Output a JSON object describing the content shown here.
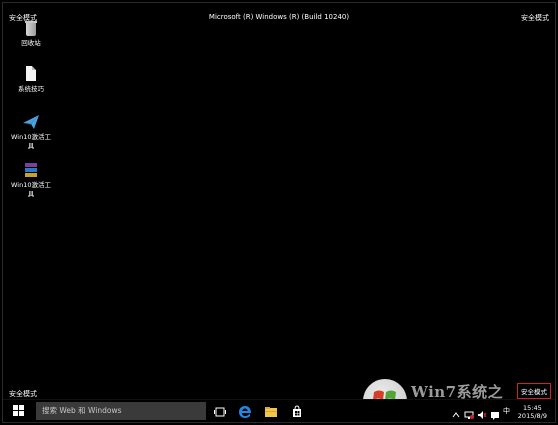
{
  "top_bar": {
    "left_label": "安全模式",
    "title": "Microsoft (R) Windows (R) (Build 10240)",
    "right_label": "安全模式"
  },
  "bottom_left_label": "安全模式",
  "desktop_icons": [
    {
      "label": "回收站",
      "icon": "recycle-bin-icon"
    },
    {
      "label": "系统技巧",
      "icon": "document-icon"
    },
    {
      "label": "Win10激活工具",
      "icon": "paper-plane-icon"
    },
    {
      "label": "Win10激活工具",
      "icon": "archive-icon"
    }
  ],
  "taskbar": {
    "search_placeholder": "搜索 Web 和 Windows",
    "tray_label": "安全模式",
    "time": "15:45",
    "date": "2015/8/9",
    "ime": "中"
  },
  "watermark": {
    "text": "Win7系统之"
  },
  "colors": {
    "background": "#000000",
    "highlight_border": "#d0202a",
    "search_box": "#3a3a3a",
    "edge_blue": "#1e88e5"
  }
}
